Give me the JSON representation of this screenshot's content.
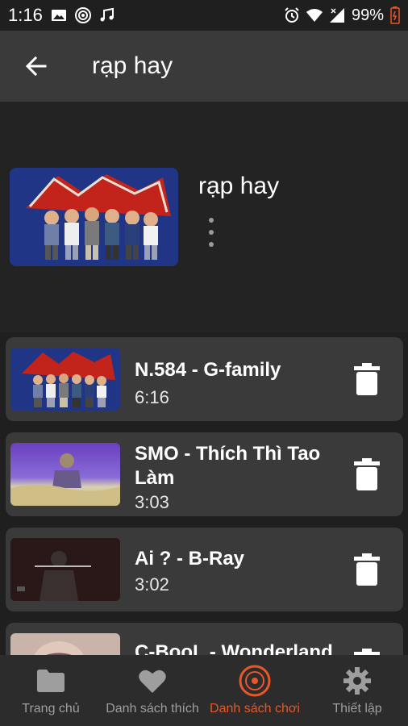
{
  "status_bar": {
    "time": "1:16",
    "battery": "99%",
    "icons_left": [
      "image-icon",
      "target-icon",
      "music-icon"
    ],
    "icons_right": [
      "alarm-icon",
      "wifi-icon",
      "signal-icon",
      "battery-icon"
    ]
  },
  "app_bar": {
    "title": "rạp hay",
    "back_icon": "arrow-back-icon"
  },
  "playlist": {
    "title": "rạp hay",
    "more_icon": "more-vertical-icon"
  },
  "tracks": [
    {
      "title": "N.584 - G-family",
      "duration": "6:16"
    },
    {
      "title": "SMO - Thích Thì Tao Làm",
      "duration": "3:03"
    },
    {
      "title": "Ai ? - B-Ray",
      "duration": "3:02"
    },
    {
      "title": "C-BooL - Wonderland",
      "duration": ""
    }
  ],
  "bottom_nav": {
    "items": [
      {
        "label": "Trang chủ",
        "icon": "folder-icon"
      },
      {
        "label": "Danh sách thích",
        "icon": "heart-icon"
      },
      {
        "label": "Danh sách chơi",
        "icon": "disc-icon"
      },
      {
        "label": "Thiết lập",
        "icon": "gear-icon"
      }
    ],
    "active_index": 2
  },
  "colors": {
    "accent": "#e8572a",
    "card_bg": "#3a3a3a",
    "app_bar_bg": "#3a3a3a",
    "background": "#1f1f1f"
  }
}
